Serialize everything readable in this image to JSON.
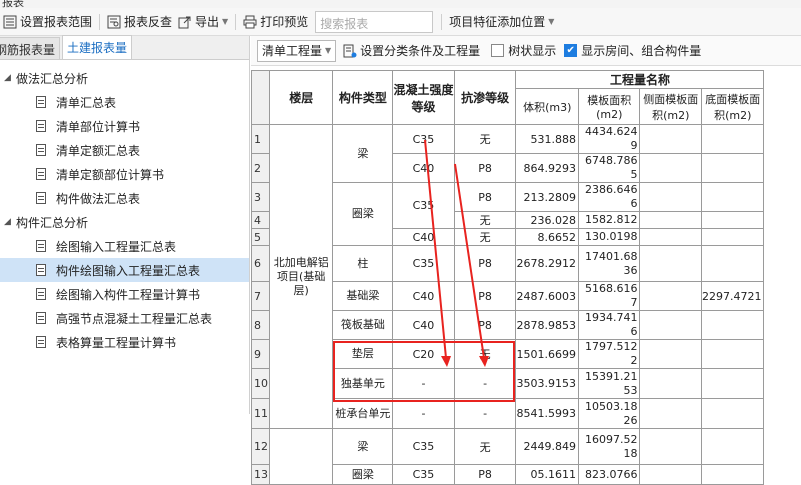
{
  "window": {
    "title": "报表"
  },
  "toolbar": {
    "items": [
      "设置报表范围",
      "报表反查",
      "导出",
      "打印预览"
    ],
    "search_placeholder": "搜索报表",
    "feature": "项目特征添加位置"
  },
  "left": {
    "tabs": [
      "钢筋报表量",
      "土建报表量"
    ],
    "groups": [
      {
        "label": "做法汇总分析",
        "items": [
          "清单汇总表",
          "清单部位计算书",
          "清单定额汇总表",
          "清单定额部位计算书",
          "构件做法汇总表"
        ]
      },
      {
        "label": "构件汇总分析",
        "items": [
          "绘图输入工程量汇总表",
          "构件绘图输入工程量汇总表",
          "绘图输入构件工程量计算书",
          "高强节点混凝土工程量汇总表",
          "表格算量工程量计算书"
        ]
      }
    ],
    "selected": "构件绘图输入工程量汇总表"
  },
  "right": {
    "combo": "清单工程量",
    "set_condition": "设置分类条件及工程量",
    "tree_display": "树状显示",
    "show_rooms": "显示房间、组合构件量",
    "tree_checked": false,
    "rooms_checked": true
  },
  "table": {
    "headers": {
      "floor": "楼层",
      "type": "构件类型",
      "grade": "混凝土强度等级",
      "seep": "抗渗等级",
      "qty": "工程量名称",
      "vol": "体积(m3)",
      "form": "模板面积(m2)",
      "side": "侧面模板面积(m2)",
      "bottom": "底面模板面积(m2)"
    },
    "floor_name": "北加电解铝项目(基础层)",
    "rows": [
      {
        "n": "1",
        "type": "梁",
        "grade": "C35",
        "seep": "无",
        "vol": "531.888",
        "form": "4434.6249",
        "side": "",
        "bottom": ""
      },
      {
        "n": "2",
        "type": "",
        "grade": "C40",
        "seep": "P8",
        "vol": "864.9293",
        "form": "6748.7865",
        "side": "",
        "bottom": ""
      },
      {
        "n": "3",
        "type": "圈梁",
        "grade": "C35",
        "seep": "P8",
        "vol": "213.2809",
        "form": "2386.6466",
        "side": "",
        "bottom": ""
      },
      {
        "n": "4",
        "type": "",
        "grade": "",
        "seep": "无",
        "vol": "236.028",
        "form": "1582.812",
        "side": "",
        "bottom": ""
      },
      {
        "n": "5",
        "type": "",
        "grade": "C40",
        "seep": "无",
        "vol": "8.6652",
        "form": "130.0198",
        "side": "",
        "bottom": ""
      },
      {
        "n": "6",
        "type": "柱",
        "grade": "C35",
        "seep": "P8",
        "vol": "2678.2912",
        "form": "17401.6836",
        "side": "",
        "bottom": ""
      },
      {
        "n": "7",
        "type": "基础梁",
        "grade": "C40",
        "seep": "P8",
        "vol": "2487.6003",
        "form": "5168.6167",
        "side": "",
        "bottom": "2297.4721"
      },
      {
        "n": "8",
        "type": "筏板基础",
        "grade": "C40",
        "seep": "P8",
        "vol": "2878.9853",
        "form": "1934.7416",
        "side": "",
        "bottom": ""
      },
      {
        "n": "9",
        "type": "垫层",
        "grade": "C20",
        "seep": "无",
        "vol": "1501.6699",
        "form": "1797.5122",
        "side": "",
        "bottom": ""
      },
      {
        "n": "10",
        "type": "独基单元",
        "grade": "-",
        "seep": "-",
        "vol": "3503.9153",
        "form": "15391.2153",
        "side": "",
        "bottom": ""
      },
      {
        "n": "11",
        "type": "桩承台单元",
        "grade": "-",
        "seep": "-",
        "vol": "8541.5993",
        "form": "10503.1826",
        "side": "",
        "bottom": ""
      },
      {
        "n": "12",
        "type": "梁",
        "grade": "C35",
        "seep": "无",
        "vol": "2449.849",
        "form": "16097.5218",
        "side": "",
        "bottom": ""
      },
      {
        "n": "13",
        "type": "圈梁",
        "grade": "C35",
        "seep": "P8",
        "vol": "05.1611",
        "form": "823.0766",
        "side": "",
        "bottom": ""
      }
    ]
  },
  "colors": {
    "annotation": "#e8231f",
    "selected_bg": "#cfe3f7",
    "tab_active": "#1b6ec2"
  }
}
